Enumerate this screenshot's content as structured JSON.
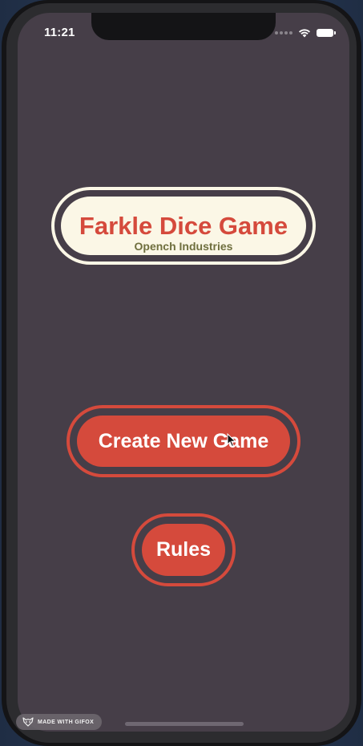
{
  "status_bar": {
    "time": "11:21"
  },
  "header": {
    "title": "Farkle Dice Game",
    "subtitle": "Opench Industries"
  },
  "actions": {
    "create_label": "Create New Game",
    "rules_label": "Rules"
  },
  "watermark": {
    "label": "MADE WITH GIFOX"
  },
  "icons": {
    "wifi": "wifi-icon",
    "battery": "battery-icon",
    "cellular": "cellular-signal-icon",
    "cursor": "mouse-pointer-icon",
    "gifox": "gifox-fox-icon"
  },
  "colors": {
    "background": "#463e48",
    "accent_red": "#d54a3c",
    "cream": "#fbf7e6",
    "subtitle_olive": "#6f6f3e"
  }
}
